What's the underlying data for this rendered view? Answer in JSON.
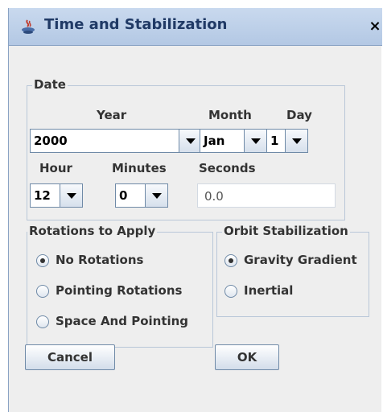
{
  "window": {
    "title": "Time and Stabilization",
    "close_symbol": "×"
  },
  "date": {
    "group_label": "Date",
    "year_label": "Year",
    "month_label": "Month",
    "day_label": "Day",
    "year_value": "2000",
    "month_value": "Jan",
    "day_value": "1",
    "hour_label": "Hour",
    "minutes_label": "Minutes",
    "seconds_label": "Seconds",
    "hour_value": "12",
    "minutes_value": "0",
    "seconds_value": "0.0"
  },
  "rotations": {
    "group_label": "Rotations to Apply",
    "options": [
      "No Rotations",
      "Pointing Rotations",
      "Space And Pointing"
    ],
    "selected": "No Rotations"
  },
  "orbit": {
    "group_label": "Orbit Stabilization",
    "options": [
      "Gravity Gradient",
      "Inertial"
    ],
    "selected": "Gravity Gradient"
  },
  "buttons": {
    "cancel": "Cancel",
    "ok": "OK"
  },
  "colors": {
    "title_bar": "#c9d9ee",
    "title_text": "#203a66",
    "border": "#b9c7d8"
  }
}
